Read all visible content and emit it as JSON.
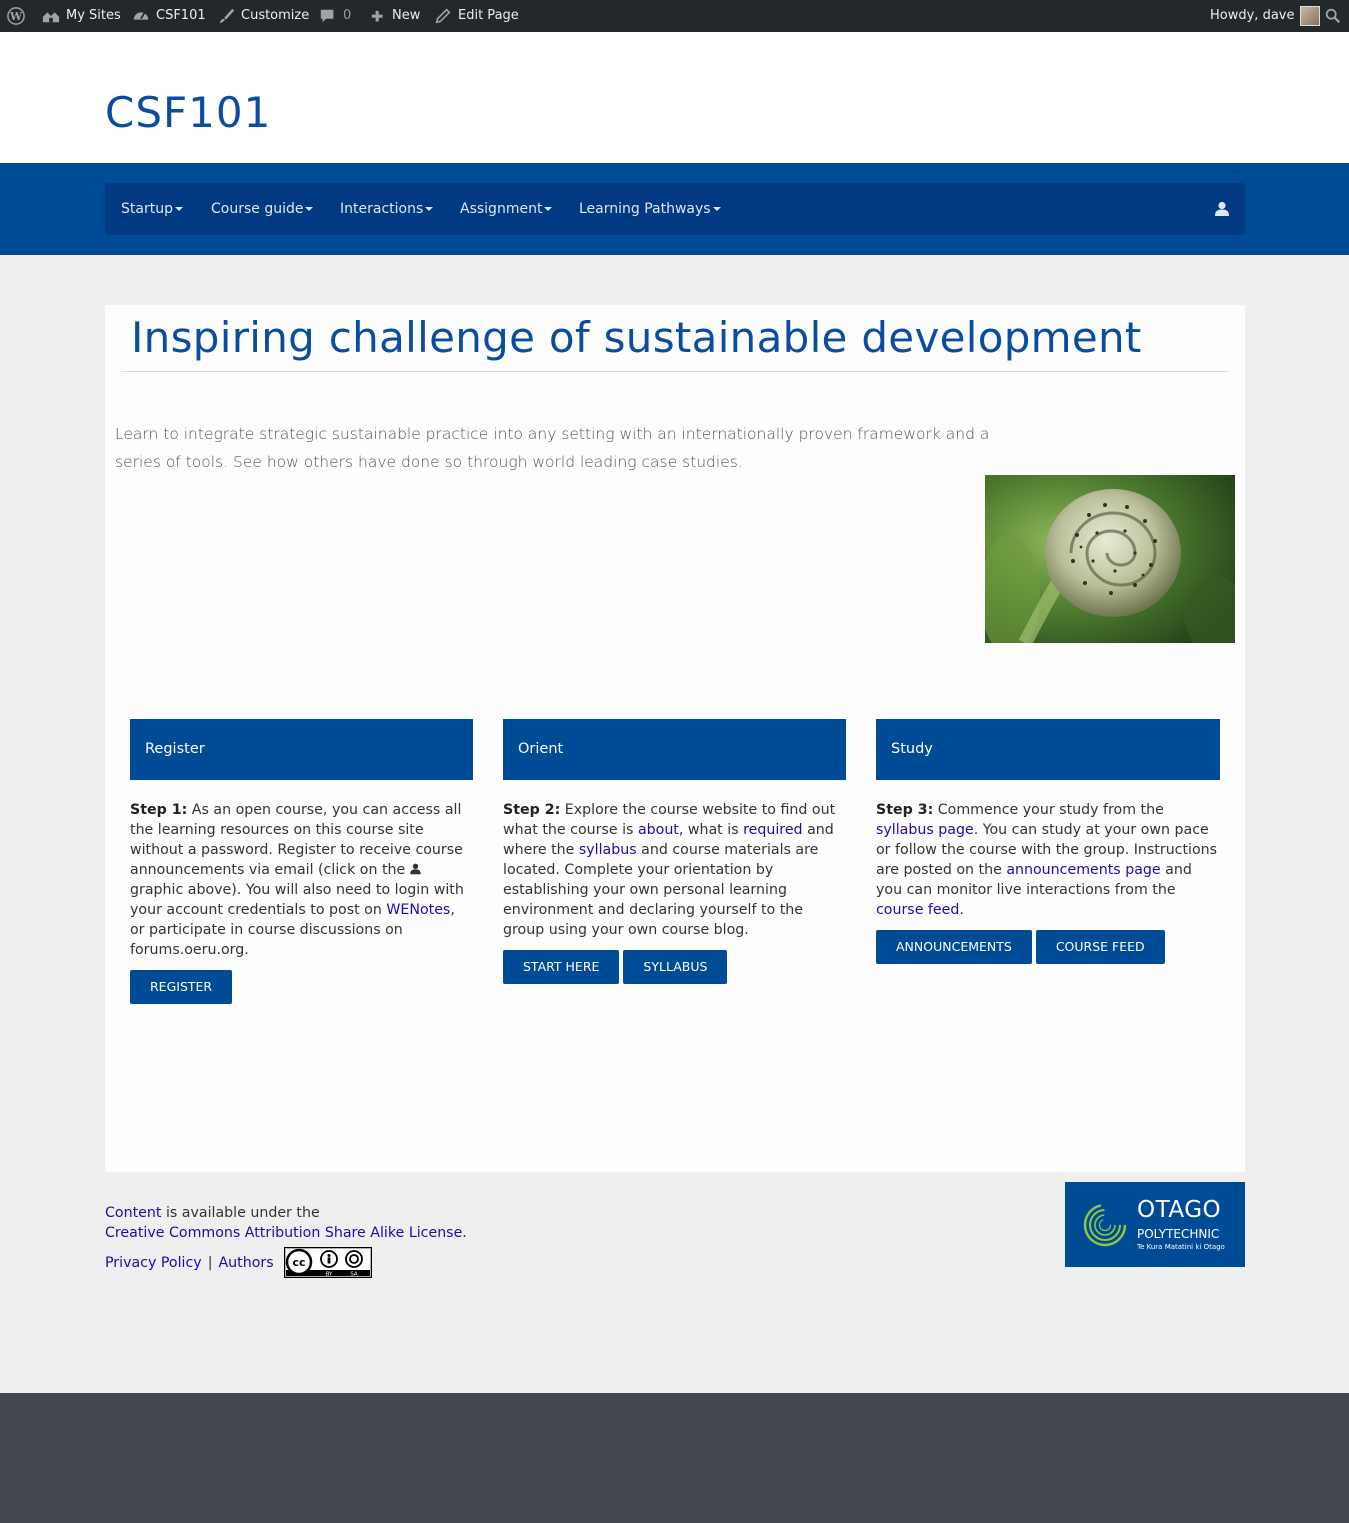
{
  "admin_bar": {
    "my_sites": "My Sites",
    "site_name": "CSF101",
    "customize": "Customize",
    "comments_count": "0",
    "new": "New",
    "edit_page": "Edit Page",
    "greeting": "Howdy, dave"
  },
  "header": {
    "site_title": "CSF101"
  },
  "nav": {
    "items": [
      {
        "label": "Startup"
      },
      {
        "label": "Course guide"
      },
      {
        "label": "Interactions"
      },
      {
        "label": "Assignment"
      },
      {
        "label": "Learning Pathways"
      }
    ]
  },
  "main": {
    "title": "Inspiring challenge of sustainable development",
    "intro": "Learn to integrate strategic sustainable practice into any setting with an internationally proven framework and a series of tools.  See how others have done so through world leading case studies.",
    "columns": [
      {
        "heading": "Register",
        "step_label": "Step 1:",
        "text_a": " As an open course, you can access all the learning resources on this course site without a password. Register to receive course announcements via email (click on the ",
        "text_b": " graphic above). You will also need to login with your account credentials to post on ",
        "link_wenotes": "WENotes",
        "text_c": ", or participate in course discussions on forums.oeru.org.",
        "buttons": [
          "REGISTER"
        ]
      },
      {
        "heading": "Orient",
        "step_label": "Step 2:",
        "text_a": " Explore the course website to find out what the course is ",
        "link_about": "about",
        "text_b": ", what is ",
        "link_required": "required",
        "text_c": " and where the ",
        "link_syllabus": "syllabus",
        "text_d": " and course materials are located. Complete your orientation by establishing your own personal learning environment and declaring yourself to the group using your own course blog.",
        "buttons": [
          "START HERE",
          "SYLLABUS"
        ]
      },
      {
        "heading": "Study",
        "step_label": "Step 3:",
        "text_a": " Commence your study from the ",
        "link_syllabus": "syllabus page",
        "text_b": ". You can study at your own pace or follow the course with the group. Instructions are posted on the ",
        "link_announcements": "announcements page",
        "text_c": " and you can monitor live interactions from the ",
        "link_feed": "course feed",
        "text_d": ".",
        "buttons": [
          "ANNOUNCEMENTS",
          "COURSE FEED"
        ]
      }
    ]
  },
  "footer": {
    "content_link": "Content",
    "available_text": " is available under the",
    "license_link": "Creative Commons Attribution Share Alike License.",
    "privacy_link": "Privacy Policy",
    "separator": "|",
    "authors_link": "Authors",
    "cc_by": "BY",
    "cc_sa": "SA",
    "otago_name": "OTAGO",
    "otago_sub": "POLYTECHNIC",
    "otago_tagline": "Te Kura Matatini ki Otago"
  },
  "colors": {
    "brand_blue": "#004b95",
    "nav_dark": "#013a82",
    "admin_bar": "#23282d",
    "title_blue": "#0a4d9e"
  }
}
